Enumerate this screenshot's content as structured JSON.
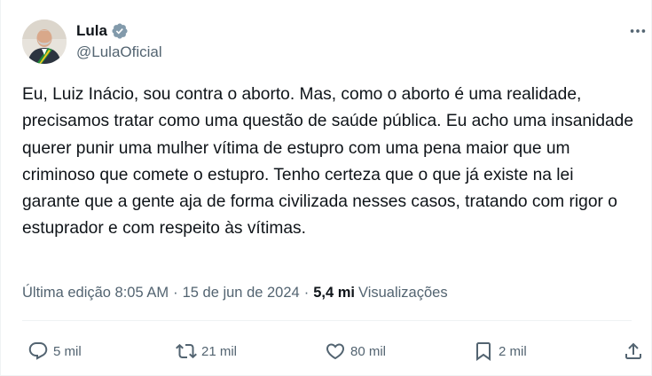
{
  "author": {
    "display_name": "Lula",
    "handle": "@LulaOficial",
    "verified": true
  },
  "tweet": {
    "text": "Eu, Luiz Inácio, sou contra o aborto. Mas, como o aborto é uma realidade, precisamos tratar como uma questão de saúde pública. Eu acho uma insanidade querer punir uma mulher vítima de estupro com uma pena maior que um criminoso que comete o estupro. Tenho certeza que o que já existe na lei garante que a gente aja de forma civilizada nesses casos, tratando com rigor o estuprador e com respeito às vítimas."
  },
  "meta": {
    "edited_label": "Última edição 8:05 AM",
    "separator": "·",
    "date": "15 de jun de 2024",
    "views_count": "5,4 mi",
    "views_label": "Visualizações"
  },
  "actions": {
    "replies": "5 mil",
    "reposts": "21 mil",
    "likes": "80 mil",
    "bookmarks": "2 mil"
  },
  "icons": {
    "more": "more-horizontal-icon",
    "verified": "verified-badge-icon",
    "reply": "reply-icon",
    "repost": "repost-icon",
    "like": "heart-icon",
    "bookmark": "bookmark-icon",
    "share": "share-icon"
  },
  "colors": {
    "text_primary": "#0f1419",
    "text_secondary": "#536471",
    "verified_badge": "#829aab",
    "divider": "#eff3f4"
  }
}
